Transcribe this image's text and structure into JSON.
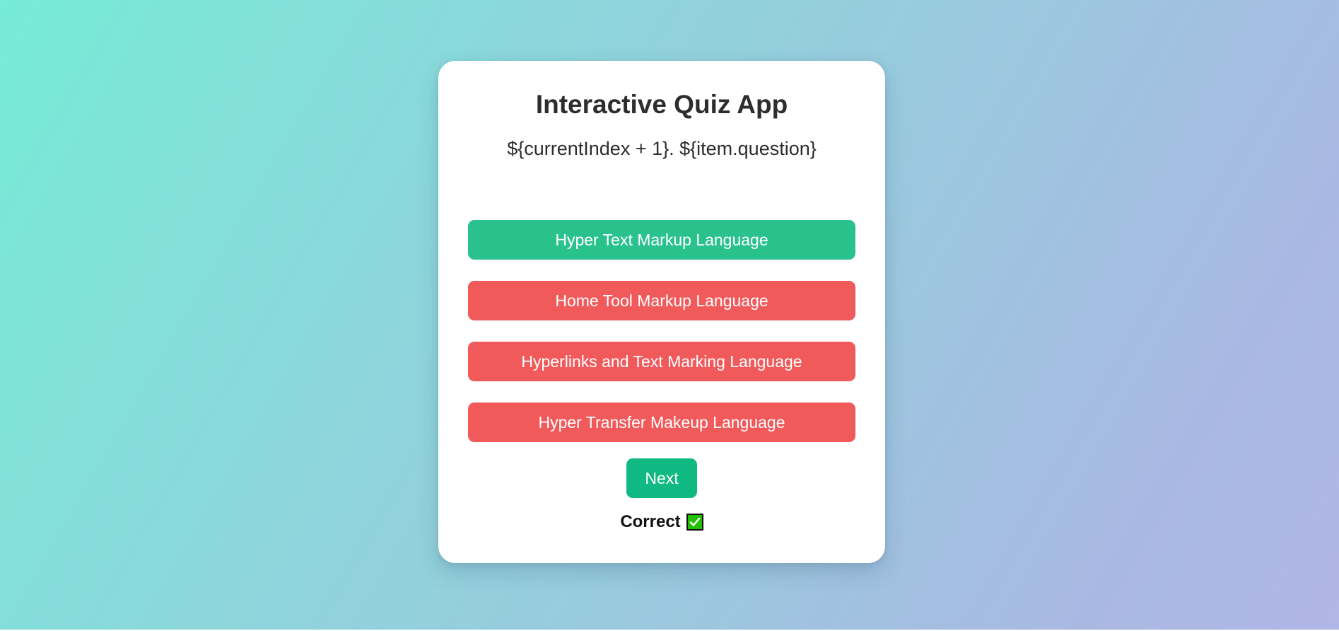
{
  "app": {
    "title": "Interactive Quiz App"
  },
  "quiz": {
    "question_text": "${currentIndex + 1}. ${item.question}",
    "options": [
      {
        "label": "Hyper Text Markup Language",
        "state": "correct"
      },
      {
        "label": "Home Tool Markup Language",
        "state": "wrong"
      },
      {
        "label": "Hyperlinks and Text Marking Language",
        "state": "wrong"
      },
      {
        "label": "Hyper Transfer Makeup Language",
        "state": "wrong"
      }
    ],
    "next_label": "Next",
    "result_label": "Correct",
    "result_icon": "check-mark-icon"
  },
  "colors": {
    "correct": "#29c28d",
    "wrong": "#f15a5b",
    "next_button": "#10b981",
    "check_icon": "#22c000"
  }
}
